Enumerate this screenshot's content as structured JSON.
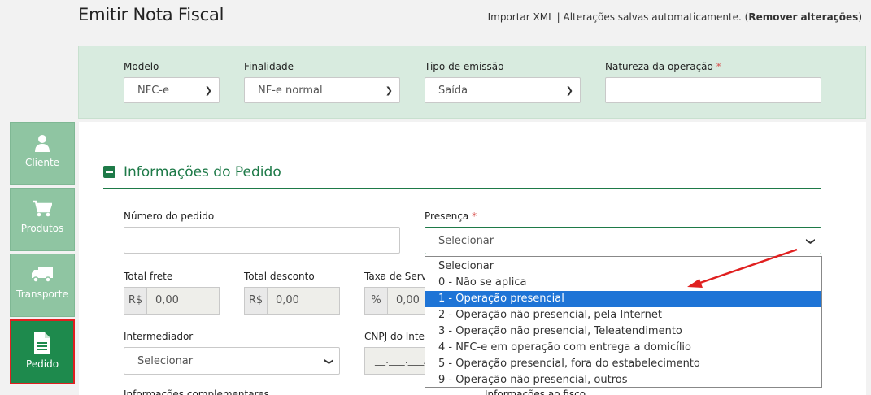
{
  "header": {
    "title": "Emitir Nota Fiscal",
    "import_link": "Importar XML",
    "separator": "|",
    "autosave_text": "Alterações salvas automaticamente. (",
    "remove_link": "Remover alterações",
    "close_paren": ")"
  },
  "top_panel": {
    "modelo": {
      "label": "Modelo",
      "value": "NFC-e"
    },
    "finalidade": {
      "label": "Finalidade",
      "value": "NF-e normal"
    },
    "tipo_emissao": {
      "label": "Tipo de emissão",
      "value": "Saída"
    },
    "natureza": {
      "label": "Natureza da operação",
      "required": "*",
      "value": ""
    }
  },
  "sidebar": {
    "items": [
      {
        "label": "Cliente",
        "icon": "user-icon"
      },
      {
        "label": "Produtos",
        "icon": "cart-icon"
      },
      {
        "label": "Transporte",
        "icon": "truck-icon"
      },
      {
        "label": "Pedido",
        "icon": "document-icon",
        "active": true
      }
    ]
  },
  "section": {
    "title": "Informações do Pedido",
    "numero_pedido": {
      "label": "Número do pedido",
      "value": ""
    },
    "presenca": {
      "label": "Presença",
      "required": "*",
      "value": "Selecionar"
    },
    "total_frete": {
      "label": "Total frete",
      "prefix": "R$",
      "value": "0,00"
    },
    "total_desconto": {
      "label": "Total desconto",
      "prefix": "R$",
      "value": "0,00"
    },
    "taxa_servico": {
      "label": "Taxa de Servi",
      "prefix": "%",
      "value": "0,00"
    },
    "intermediador": {
      "label": "Intermediador",
      "value": "Selecionar"
    },
    "cnpj_intermediador": {
      "label": "CNPJ do Inte",
      "value": "__.___.___/"
    },
    "cutoff_left": "Informações complementares",
    "cutoff_right": "Informações ao fisco"
  },
  "presenca_dropdown": {
    "options": [
      "Selecionar",
      "0 - Não se aplica",
      "1 - Operação presencial",
      "2 - Operação não presencial, pela Internet",
      "3 - Operação não presencial, Teleatendimento",
      "4 - NFC-e em operação com entrega a domicílio",
      "5 - Operação presencial, fora do estabelecimento",
      "9 - Operação não presencial, outros"
    ],
    "highlighted_index": 2
  },
  "colors": {
    "brand_green": "#1e7a48",
    "sidebar_green": "#8fc5a2",
    "active_green": "#1e8a4d",
    "highlight_blue": "#1e74d6",
    "annotation_red": "#e02020"
  }
}
